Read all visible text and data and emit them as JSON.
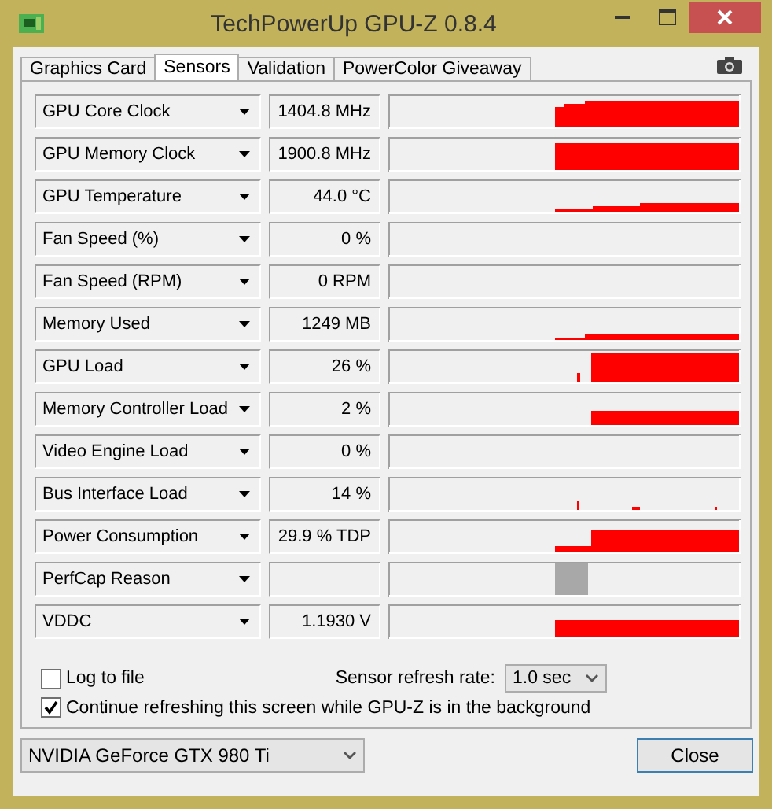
{
  "window": {
    "title": "TechPowerUp GPU-Z 0.8.4"
  },
  "tabs": [
    {
      "label": "Graphics Card",
      "selected": false
    },
    {
      "label": "Sensors",
      "selected": true
    },
    {
      "label": "Validation",
      "selected": false
    },
    {
      "label": "PowerColor Giveaway",
      "selected": false
    }
  ],
  "sensors": [
    {
      "name": "GPU Core Clock",
      "value": "1404.8 MHz"
    },
    {
      "name": "GPU Memory Clock",
      "value": "1900.8 MHz"
    },
    {
      "name": "GPU Temperature",
      "value": "44.0 °C"
    },
    {
      "name": "Fan Speed (%)",
      "value": "0 %"
    },
    {
      "name": "Fan Speed (RPM)",
      "value": "0 RPM"
    },
    {
      "name": "Memory Used",
      "value": "1249 MB"
    },
    {
      "name": "GPU Load",
      "value": "26 %"
    },
    {
      "name": "Memory Controller Load",
      "value": "2 %"
    },
    {
      "name": "Video Engine Load",
      "value": "0 %"
    },
    {
      "name": "Bus Interface Load",
      "value": "14 %"
    },
    {
      "name": "Power Consumption",
      "value": "29.9 % TDP"
    },
    {
      "name": "PerfCap Reason"
    },
    {
      "name": "VDDC",
      "value": "1.1930 V"
    }
  ],
  "log_to_file": {
    "label": "Log to file",
    "checked": false
  },
  "refresh_rate": {
    "label": "Sensor refresh rate:",
    "value": "1.0 sec"
  },
  "continue_refreshing": {
    "label": "Continue refreshing this screen while GPU-Z is in the background",
    "checked": true
  },
  "gpu_select": {
    "value": "NVIDIA GeForce GTX 980 Ti"
  },
  "buttons": [
    "Close"
  ]
}
